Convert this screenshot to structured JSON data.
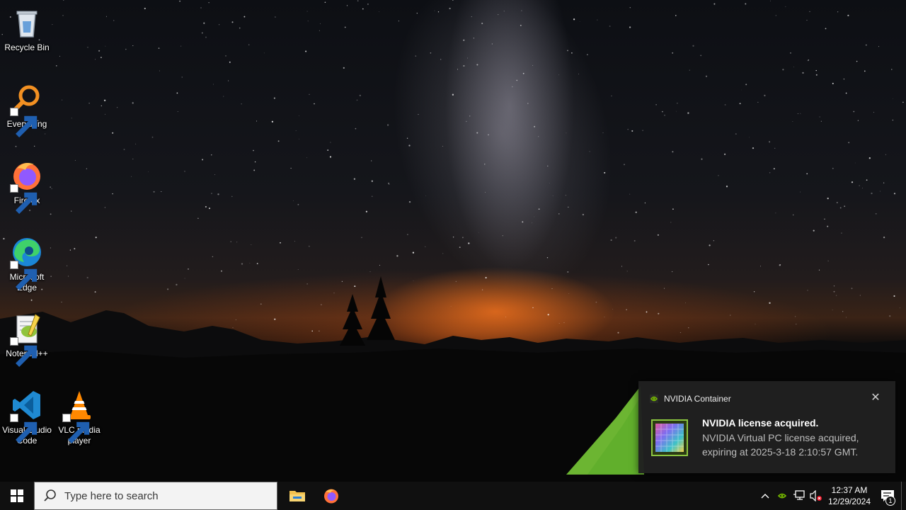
{
  "desktop": {
    "icons": [
      {
        "label": "Recycle Bin",
        "icon": "recycle-bin-icon"
      },
      {
        "label": "Everything",
        "icon": "everything-search-icon"
      },
      {
        "label": "Firefox",
        "icon": "firefox-icon"
      },
      {
        "label": "Microsoft Edge",
        "icon": "edge-icon"
      },
      {
        "label": "Notepad++",
        "icon": "notepad-plus-plus-icon"
      },
      {
        "label": "Visual Studio Code",
        "icon": "vscode-icon"
      },
      {
        "label": "VLC media player",
        "icon": "vlc-icon"
      }
    ]
  },
  "notification": {
    "app_name": "NVIDIA Container",
    "title": "NVIDIA license acquired.",
    "body": "NVIDIA Virtual PC license acquired, expiring at 2025-3-18 2:10:57 GMT.",
    "close_glyph": "✕"
  },
  "taskbar": {
    "search_placeholder": "Type here to search",
    "pinned": [
      "file-explorer-icon",
      "firefox-icon"
    ],
    "clock": {
      "time": "12:37 AM",
      "date": "12/29/2024"
    },
    "tray_icons": [
      "chevron-up-icon",
      "nvidia-icon",
      "network-icon",
      "volume-muted-icon",
      "action-center-icon"
    ],
    "notification_count": "1"
  },
  "colors": {
    "taskbar_bg": "#101010",
    "toast_bg": "#202020",
    "nvidia_green": "#76b900"
  }
}
